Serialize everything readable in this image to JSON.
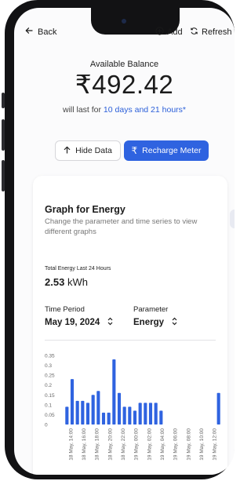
{
  "header": {
    "back_label": "Back",
    "add_label": "Add",
    "refresh_label": "Refresh"
  },
  "balance": {
    "label": "Available Balance",
    "amount": "₹492.42",
    "note_prefix": "will last for ",
    "note_highlight": "10 days and 21 hours*"
  },
  "actions": {
    "hide_label": "Hide Data",
    "recharge_label": "Recharge Meter"
  },
  "card": {
    "title": "Graph for Energy",
    "subtitle": "Change the parameter and time series to view different graphs",
    "total_label": "Total Energy Last 24 Hours",
    "total_value": "2.53",
    "total_unit": "kWh",
    "time_period_label": "Time Period",
    "time_period_value": "May 19, 2024",
    "parameter_label": "Parameter",
    "parameter_value": "Energy"
  },
  "colors": {
    "accent": "#2f63e0",
    "bar": "#2f63e0"
  },
  "chart_data": {
    "type": "bar",
    "ylim": [
      0,
      0.35
    ],
    "yticks": [
      "0.35",
      "0.3",
      "0.25",
      "0.2",
      "0.15",
      "0.1",
      "0.05",
      "0"
    ],
    "tick_labels": [
      "18 May, 14:00",
      "18 May, 16:00",
      "18 May, 18:00",
      "18 May, 20:00",
      "18 May, 22:00",
      "19 May, 00:00",
      "19 May, 02:00",
      "19 May, 04:00",
      "19 May, 06:00",
      "19 May, 08:00",
      "19 May, 10:00",
      "19 May, 12:00"
    ],
    "values": [
      0.09,
      0.23,
      0.12,
      0.12,
      0.11,
      0.15,
      0.17,
      0.06,
      0.06,
      0.33,
      0.16,
      0.09,
      0.09,
      0.07,
      0.11,
      0.11,
      0.11,
      0.11,
      0.07,
      0,
      0,
      0,
      0,
      0,
      0,
      0,
      0,
      0,
      0,
      0.16
    ]
  }
}
